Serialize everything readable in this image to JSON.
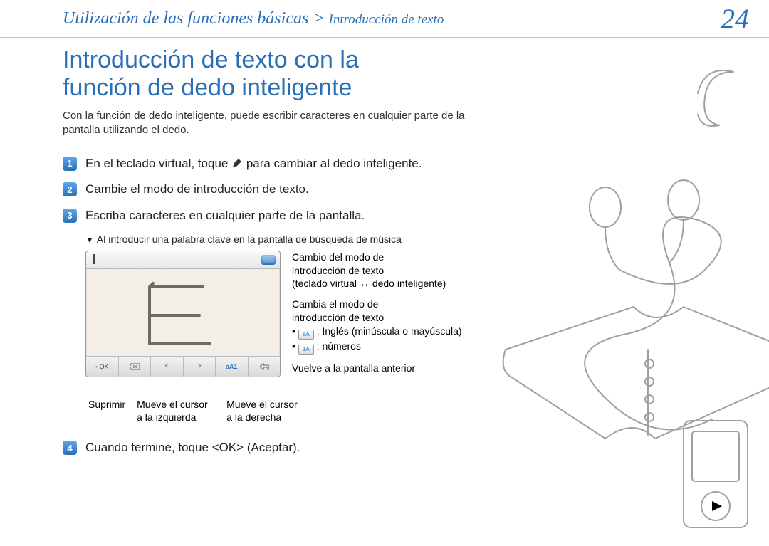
{
  "header": {
    "breadcrumb_main": "Utilización de las funciones básicas",
    "breadcrumb_sep": " > ",
    "breadcrumb_sub": "Introducción de texto",
    "page_number": "24"
  },
  "title_line1": "Introducción de texto con la",
  "title_line2": "función de dedo inteligente",
  "intro": "Con la función de dedo inteligente, puede escribir caracteres en cualquier parte de la pantalla utilizando el dedo.",
  "steps": {
    "s1_a": "En el teclado virtual, toque ",
    "s1_b": " para cambiar al dedo inteligente.",
    "s2": "Cambie el modo de introducción de texto.",
    "s3": "Escriba caracteres en cualquier parte de la pantalla.",
    "s4": "Cuando termine, toque <OK> (Aceptar)."
  },
  "sub_note": "Al introducir una palabra clave en la pantalla de búsqueda de música",
  "virtual_screen": {
    "ok_label": "OK",
    "mode_label": "aA1"
  },
  "callouts_right": {
    "c1_l1": "Cambio del modo de",
    "c1_l2": "introducción de texto",
    "c1_l3": "(teclado virtual ↔ dedo inteligente)",
    "c2_l1": "Cambia el modo de",
    "c2_l2": "introducción de texto",
    "c2_b1_label": "aA",
    "c2_b1_text": " : Inglés (minúscula o mayúscula)",
    "c2_b2_label": "1A",
    "c2_b2_text": " : números",
    "c3": "Vuelve a la pantalla anterior"
  },
  "callouts_below": {
    "cb1": "Suprimir",
    "cb2": "Mueve el cursor a la izquierda",
    "cb3": "Mueve el cursor a la derecha"
  }
}
